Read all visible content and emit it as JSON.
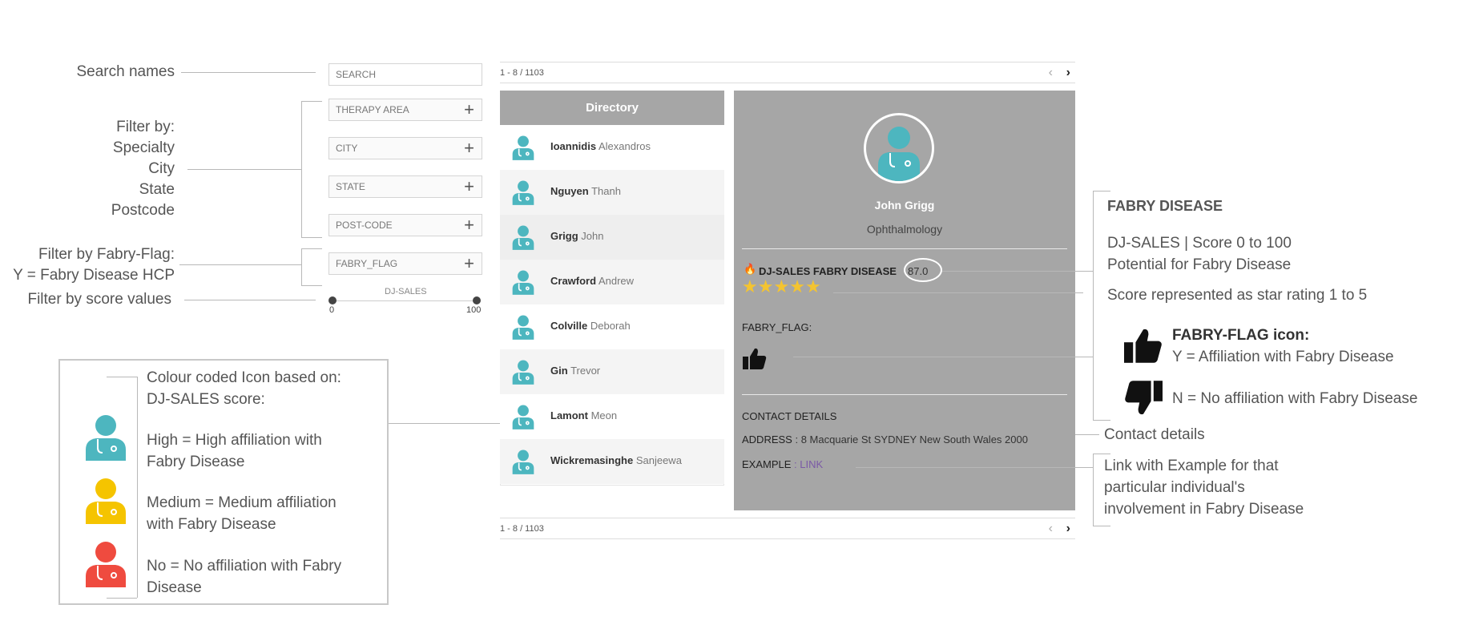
{
  "annotations": {
    "search_names": "Search names",
    "filter_by": [
      "Filter by:",
      "Specialty",
      "City",
      "State",
      "Postcode"
    ],
    "filter_fabry": [
      "Filter by Fabry-Flag:",
      "Y = Fabry Disease HCP"
    ],
    "filter_score": "Filter by score values",
    "fabry_title": "FABRY DISEASE",
    "score_desc": [
      "DJ-SALES | Score 0 to 100",
      "Potential for Fabry Disease"
    ],
    "star_desc": "Score represented as star rating 1 to 5",
    "flag_icon_title": "FABRY-FLAG icon:",
    "flag_yes": "Y = Affiliation with Fabry Disease",
    "flag_no": "N = No affiliation with Fabry Disease",
    "contact_details": "Contact details",
    "link_desc": [
      "Link with Example for that",
      "particular individual's",
      "involvement in Fabry Disease"
    ]
  },
  "legend": {
    "intro": [
      "Colour coded Icon based on:",
      "DJ-SALES score:"
    ],
    "high": [
      "High = High affiliation with",
      "Fabry Disease"
    ],
    "medium": [
      "Medium = Medium affiliation",
      "with Fabry Disease"
    ],
    "no": [
      "No = No affiliation with Fabry",
      "Disease"
    ],
    "colors": {
      "high": "#4db6bf",
      "medium": "#f5c400",
      "no": "#ef4b3f"
    }
  },
  "filters": {
    "search_placeholder": "SEARCH",
    "therapy_area": "THERAPY AREA",
    "city": "CITY",
    "state": "STATE",
    "postcode": "POST-CODE",
    "fabry_flag": "FABRY_FLAG",
    "slider_label": "DJ-SALES",
    "slider_min": "0",
    "slider_max": "100"
  },
  "pager": {
    "range": "1 - 8 / 1103",
    "prev": "‹",
    "next": "›"
  },
  "directory": {
    "title": "Directory",
    "people": [
      {
        "last": "Ioannidis",
        "first": "Alexandros"
      },
      {
        "last": "Nguyen",
        "first": "Thanh"
      },
      {
        "last": "Grigg",
        "first": "John"
      },
      {
        "last": "Crawford",
        "first": "Andrew"
      },
      {
        "last": "Colville",
        "first": "Deborah"
      },
      {
        "last": "Gin",
        "first": "Trevor"
      },
      {
        "last": "Lamont",
        "first": "Meon"
      },
      {
        "last": "Wickremasinghe",
        "first": "Sanjeewa"
      }
    ]
  },
  "detail": {
    "name": "John Grigg",
    "specialty": "Ophthalmology",
    "score_label": "DJ-SALES FABRY DISEASE",
    "score_value": "87.0",
    "stars": 5,
    "flag_label": "FABRY_FLAG:",
    "contact_title": "CONTACT DETAILS",
    "address_label": "ADDRESS",
    "address_value": ": 8 Macquarie St SYDNEY New South Wales 2000",
    "example_label": "EXAMPLE",
    "example_sep": ":",
    "example_link": "LINK"
  },
  "icons": {
    "avatar": "doctor-icon",
    "flag": "thumbs-up-icon",
    "fire": "fire-icon",
    "star": "star-icon"
  }
}
